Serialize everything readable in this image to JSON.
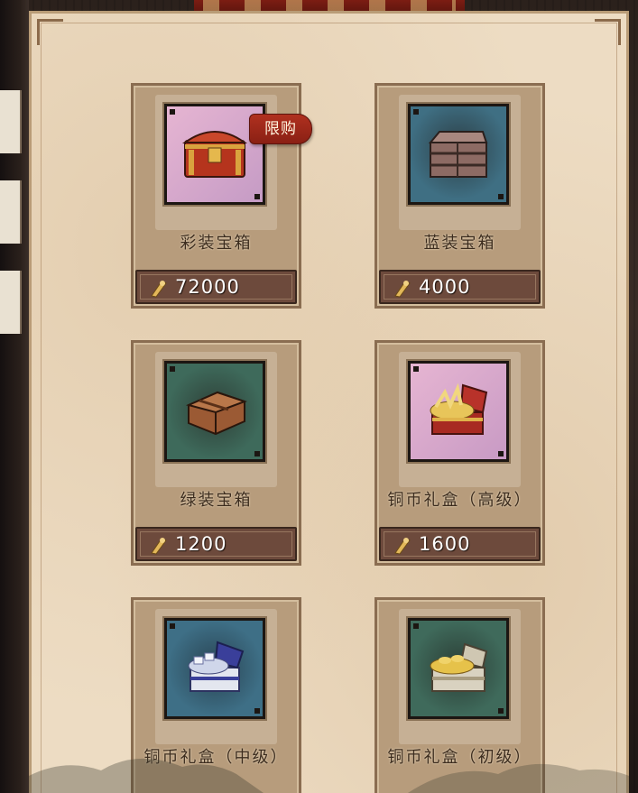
{
  "shop": {
    "limited_tag": "限购",
    "items": [
      {
        "name": "彩装宝箱",
        "price": "72000",
        "icon": "rainbow-chest-icon",
        "bg": "#d9a7c8"
      },
      {
        "name": "蓝装宝箱",
        "price": "4000",
        "icon": "blue-chest-icon",
        "bg": "#3f6f83"
      },
      {
        "name": "绿装宝箱",
        "price": "1200",
        "icon": "green-chest-icon",
        "bg": "#3e6a5b"
      },
      {
        "name": "铜币礼盒（高级）",
        "price": "1600",
        "icon": "gold-giftbox-icon",
        "bg": "#d9a2c6"
      },
      {
        "name": "铜币礼盒（中级）",
        "price": "",
        "icon": "silver-giftbox-icon",
        "bg": "#3e6f86"
      },
      {
        "name": "铜币礼盒（初级）",
        "price": "",
        "icon": "copper-giftbox-icon",
        "bg": "#3f6a5b"
      }
    ],
    "currency_icon": "jade-coin-icon"
  }
}
